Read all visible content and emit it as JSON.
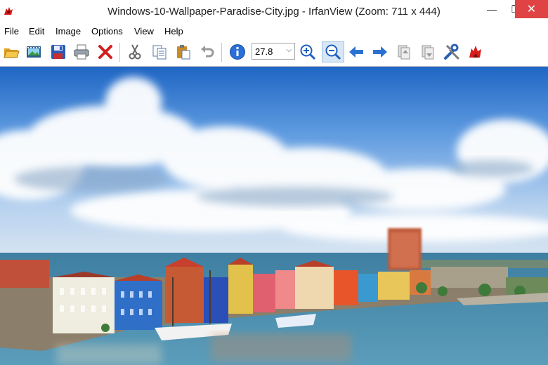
{
  "window": {
    "title": "Windows-10-Wallpaper-Paradise-City.jpg - IrfanView (Zoom: 711 x 444)",
    "min_glyph": "—",
    "max_glyph": "❐",
    "close_glyph": "✕"
  },
  "menu": {
    "items": [
      "File",
      "Edit",
      "Image",
      "Options",
      "View",
      "Help"
    ]
  },
  "toolbar": {
    "zoom_value": "27.8",
    "dropdown_arrow": "⌵",
    "buttons": [
      "open-folder-icon",
      "thumbnails-icon",
      "save-icon",
      "print-icon",
      "delete-icon",
      "cut-icon",
      "copy-icon",
      "paste-icon",
      "undo-icon",
      "info-icon",
      "zoom-in-icon",
      "zoom-out-icon",
      "previous-icon",
      "next-icon",
      "first-page-icon",
      "last-page-icon",
      "settings-icon",
      "irfanview-cat-icon"
    ]
  },
  "colors": {
    "close_button": "#e04343",
    "sky_top": "#2c73c8",
    "sea": "#3c84a8"
  }
}
